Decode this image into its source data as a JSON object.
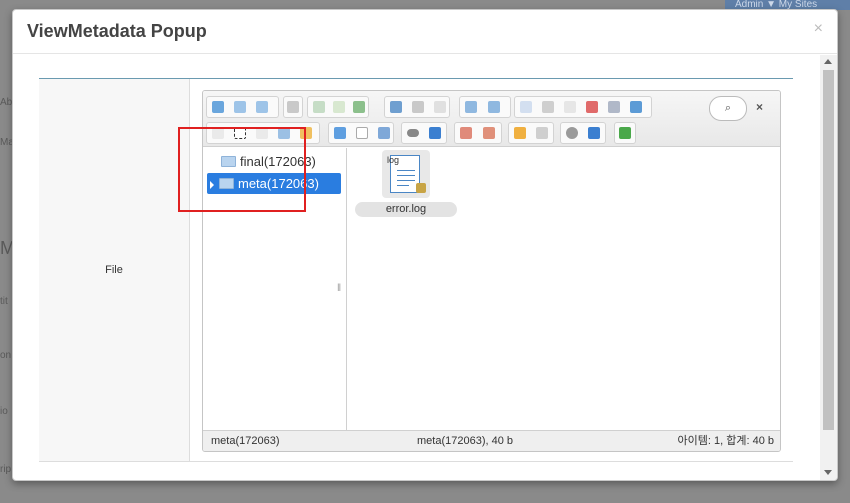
{
  "background": {
    "topbar_text": "Admin ▼    My Sites",
    "left_fragments": [
      "Ab",
      "Ma",
      "M",
      "tit",
      "on",
      "io",
      "rip"
    ]
  },
  "modal": {
    "title": "ViewMetadata Popup",
    "close": "×",
    "field_label": "File"
  },
  "finder": {
    "toolbar": {
      "search_icon": "⌕",
      "clear": "×",
      "buttons": [
        "back-icon",
        "forward-icon",
        "up-icon",
        "reload-icon",
        "home-icon",
        "open-icon",
        "save-icon",
        "get-file-icon",
        "download-icon",
        "select-icon",
        "undo-icon",
        "redo-icon",
        "copy-icon",
        "cut-icon",
        "paste-icon",
        "delete-icon",
        "empty-icon",
        "duplicate-icon",
        "new-file-icon",
        "new-folder-icon",
        "new-doc-icon",
        "extract-icon",
        "archive-icon",
        "select-all-icon",
        "select-none-icon",
        "invert-icon",
        "view-icon",
        "info-icon",
        "rename-icon",
        "edit-icon",
        "list-view-icon",
        "sort-icon",
        "preferences-icon",
        "help-icon",
        "fullscreen-icon"
      ]
    },
    "tree": [
      {
        "label": "final(172063)",
        "active": false
      },
      {
        "label": "meta(172063)",
        "active": true
      }
    ],
    "files": [
      {
        "name": "error.log",
        "tag": "log",
        "icon": "log-file-icon",
        "locked": true
      }
    ],
    "status": {
      "path": "meta(172063)",
      "size": "meta(172063), 40 b",
      "items": "아이템: 1, 합계: 40 b"
    }
  },
  "colors": {
    "accent": "#2a7de0",
    "highlight_border": "#e02020"
  }
}
